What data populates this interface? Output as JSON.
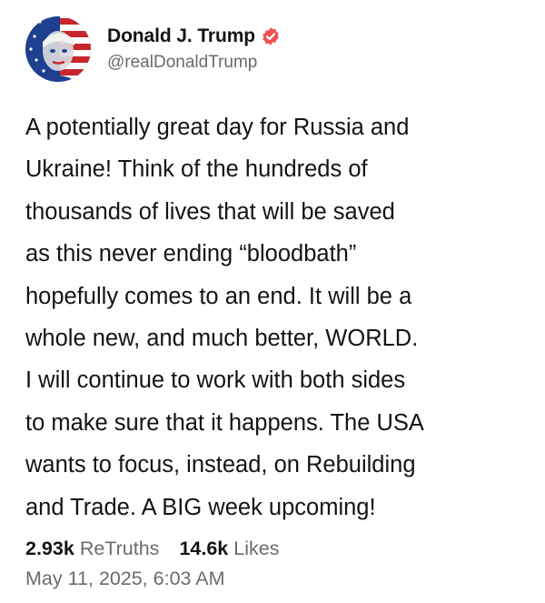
{
  "author": {
    "display_name": "Donald J. Trump",
    "handle": "@realDonaldTrump",
    "verified_icon": "verified-badge-icon",
    "verified_color": "#f0534f"
  },
  "post": {
    "text": "A potentially great day for Russia and\nUkraine! Think of the hundreds of\nthousands of lives that will be saved\nas this never ending “bloodbath”\nhopefully comes to an end. It will be a\nwhole new, and much better, WORLD.\nI will continue to work with both sides\nto make sure that it happens. The USA\nwants to focus, instead, on Rebuilding\nand Trade. A BIG week upcoming!",
    "retruths_count": "2.93k",
    "retruths_label": "ReTruths",
    "likes_count": "14.6k",
    "likes_label": "Likes",
    "timestamp": "May 11, 2025, 6:03 AM"
  },
  "colors": {
    "text": "#141414",
    "muted": "#6b6b6b",
    "avatar_blue": "#1f3f8f",
    "avatar_red": "#c8262d"
  }
}
